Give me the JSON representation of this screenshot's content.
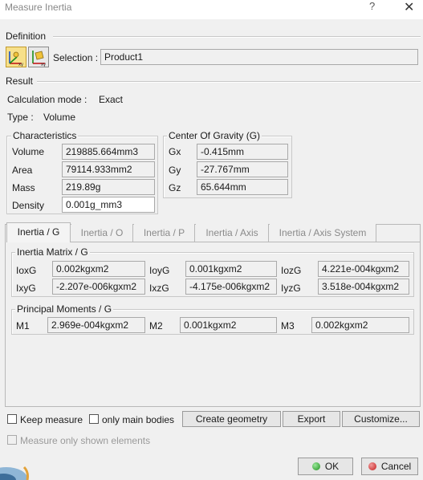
{
  "window": {
    "title": "Measure Inertia",
    "help": "?",
    "close": "✕"
  },
  "definition": {
    "title": "Definition",
    "selection_label": "Selection :",
    "selection_value": "Product1",
    "tool1_icon": "measure-inertia-3d-icon",
    "tool2_icon": "measure-inertia-2d-icon"
  },
  "result": {
    "title": "Result",
    "calc_mode_label": "Calculation mode :",
    "calc_mode_value": "Exact",
    "type_label": "Type :",
    "type_value": "Volume"
  },
  "characteristics": {
    "title": "Characteristics",
    "rows": [
      {
        "label": "Volume",
        "value": "219885.664mm3"
      },
      {
        "label": "Area",
        "value": "79114.933mm2"
      },
      {
        "label": "Mass",
        "value": "219.89g"
      },
      {
        "label": "Density",
        "value": "0.001g_mm3"
      }
    ]
  },
  "cog": {
    "title": "Center Of Gravity (G)",
    "rows": [
      {
        "label": "Gx",
        "value": "-0.415mm"
      },
      {
        "label": "Gy",
        "value": "-27.767mm"
      },
      {
        "label": "Gz",
        "value": "65.644mm"
      }
    ]
  },
  "tabs": [
    {
      "label": "Inertia / G",
      "active": true
    },
    {
      "label": "Inertia / O"
    },
    {
      "label": "Inertia / P"
    },
    {
      "label": "Inertia / Axis"
    },
    {
      "label": "Inertia / Axis System"
    }
  ],
  "inertia_matrix": {
    "title": "Inertia Matrix / G",
    "row1": [
      {
        "label": "IoxG",
        "value": "0.002kgxm2"
      },
      {
        "label": "IoyG",
        "value": "0.001kgxm2"
      },
      {
        "label": "IozG",
        "value": "4.221e-004kgxm2"
      }
    ],
    "row2": [
      {
        "label": "IxyG",
        "value": "-2.207e-006kgxm2"
      },
      {
        "label": "IxzG",
        "value": "-4.175e-006kgxm2"
      },
      {
        "label": "IyzG",
        "value": "3.518e-004kgxm2"
      }
    ]
  },
  "principal": {
    "title": "Principal Moments / G",
    "items": [
      {
        "label": "M1",
        "value": "2.969e-004kgxm2"
      },
      {
        "label": "M2",
        "value": "0.001kgxm2"
      },
      {
        "label": "M3",
        "value": "0.002kgxm2"
      }
    ]
  },
  "options": {
    "keep_measure": "Keep measure",
    "only_main_bodies": "only main bodies",
    "measure_only_shown": "Measure only shown elements"
  },
  "buttons": {
    "create_geometry": "Create geometry",
    "export": "Export",
    "customize": "Customize...",
    "ok": "OK",
    "cancel": "Cancel"
  }
}
